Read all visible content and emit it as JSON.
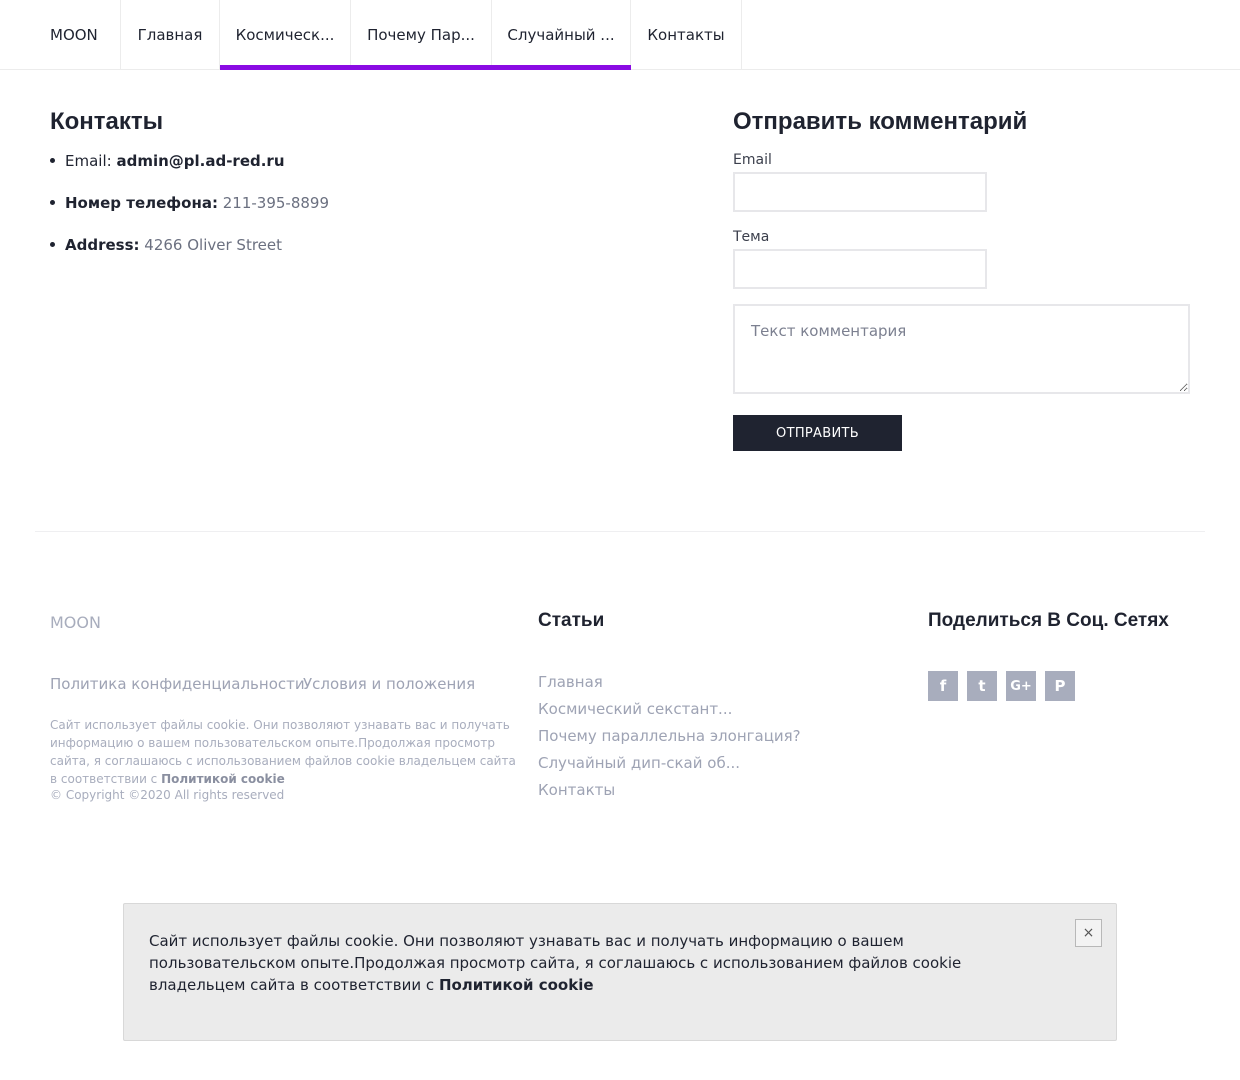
{
  "nav": {
    "brand": "MOON",
    "items": [
      {
        "label": "Главная"
      },
      {
        "label": "Космическ..."
      },
      {
        "label": "Почему Пар..."
      },
      {
        "label": "Случайный ..."
      },
      {
        "label": "Контакты"
      }
    ],
    "accent_color": "#8a0be3"
  },
  "contacts": {
    "title": "Контакты",
    "email_key": "Email:",
    "email_value": "admin@pl.ad-red.ru",
    "phone_key": "Номер телефона:",
    "phone_value": "211-395-8899",
    "address_key": "Address:",
    "address_value": "4266 Oliver Street"
  },
  "form": {
    "title": "Отправить комментарий",
    "email_label": "Email",
    "email_value": "",
    "subject_label": "Тема",
    "subject_value": "",
    "comment_placeholder": "Текст комментария",
    "submit_label": "ОТПРАВИТЬ"
  },
  "footer": {
    "brand": "MOON",
    "privacy_link": "Политика конфиденциальности",
    "terms_link": "Условия и положения",
    "cookie_text": "Сайт использует файлы cookie. Они позволяют узнавать вас и получать информацию о вашем пользовательском опыте.Продолжая просмотр сайта, я соглашаюсь с использованием файлов cookie владельцем сайта в соответствии с",
    "cookie_policy_link": "Политикой cookie",
    "copyright": "© Copyright ©2020 All rights reserved",
    "articles_title": "Статьи",
    "articles": [
      {
        "label": "Главная"
      },
      {
        "label": "Космический секстант..."
      },
      {
        "label": "Почему параллельна элонгация?"
      },
      {
        "label": "Случайный дип-скай об..."
      },
      {
        "label": "Контакты"
      }
    ],
    "social_title": "Поделиться В Соц. Сетях",
    "social_icons": [
      {
        "name": "facebook-icon",
        "glyph": "f"
      },
      {
        "name": "twitter-icon",
        "glyph": "t"
      },
      {
        "name": "google-plus-icon",
        "glyph": "G+"
      },
      {
        "name": "pinterest-icon",
        "glyph": "P"
      }
    ]
  },
  "cookie_bar": {
    "text": "Сайт использует файлы cookie. Они позволяют узнавать вас и получать информацию о вашем пользовательском опыте.Продолжая просмотр сайта, я соглашаюсь с использованием файлов cookie владельцем сайта в соответствии с",
    "policy_link": "Политикой cookie",
    "close_glyph": "×"
  }
}
